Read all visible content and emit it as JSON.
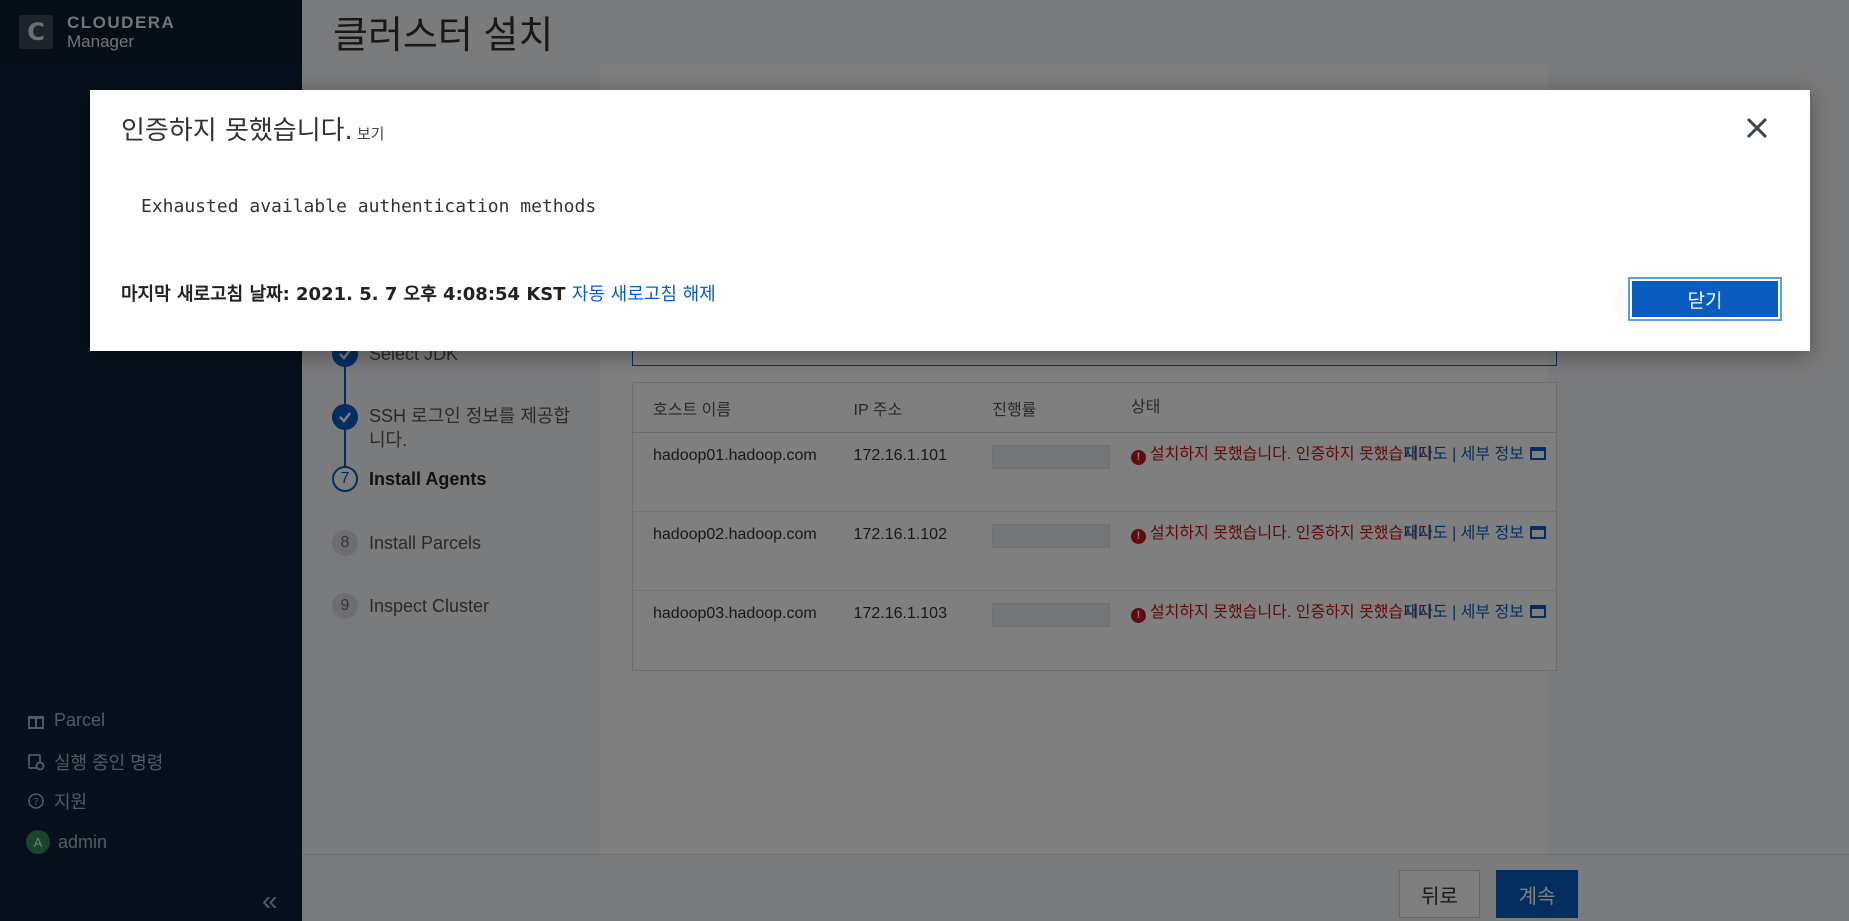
{
  "app": {
    "brand": "CLOUDERA",
    "product": "Manager",
    "logo_letter": "C"
  },
  "sidebar": {
    "items": [
      {
        "label": "Parcel",
        "icon": "gift-icon"
      },
      {
        "label": "실행 중인 명령",
        "icon": "commands-icon"
      },
      {
        "label": "지원",
        "icon": "help-circle-icon"
      },
      {
        "label": "admin",
        "icon": "avatar",
        "avatar_letter": "A"
      }
    ],
    "collapse_glyph": "«"
  },
  "page": {
    "title": "클러스터 설치"
  },
  "wizard": {
    "steps": [
      {
        "number": "",
        "label": "Select JDK",
        "state": "done"
      },
      {
        "number": "",
        "label": "SSH 로그인 정보를 제공합니다.",
        "state": "done"
      },
      {
        "number": "7",
        "label": "Install Agents",
        "state": "current"
      },
      {
        "number": "8",
        "label": "Install Parcels",
        "state": "todo"
      },
      {
        "number": "9",
        "label": "Inspect Cluster",
        "state": "todo"
      }
    ]
  },
  "hosts_table": {
    "headers": [
      "호스트 이름",
      "IP 주소",
      "진행률",
      "상태"
    ],
    "rows": [
      {
        "host": "hadoop01.hadoop.com",
        "ip": "172.16.1.101",
        "status": "설치하지 못했습니다. 인증하지 못했습니다.",
        "retry": "재시도",
        "sep": "|",
        "details": "세부 정보"
      },
      {
        "host": "hadoop02.hadoop.com",
        "ip": "172.16.1.102",
        "status": "설치하지 못했습니다. 인증하지 못했습니다.",
        "retry": "재시도",
        "sep": "|",
        "details": "세부 정보"
      },
      {
        "host": "hadoop03.hadoop.com",
        "ip": "172.16.1.103",
        "status": "설치하지 못했습니다. 인증하지 못했습니다.",
        "retry": "재시도",
        "sep": "|",
        "details": "세부 정보"
      }
    ]
  },
  "footer": {
    "back_label": "뒤로",
    "next_label": "계속"
  },
  "modal": {
    "title": "인증하지 못했습니다.",
    "view_link": "보기",
    "message": "Exhausted available authentication methods",
    "refresh_text": "마지막 새로고침 날짜: 2021. 5. 7 오후 4:08:54 KST",
    "auto_refresh_link": "자동 새로고침 해제",
    "close_button": "닫기"
  },
  "colors": {
    "sidebar_bg": "#0c2138",
    "accent_blue": "#0a5cc0",
    "error_red": "#c01818"
  }
}
